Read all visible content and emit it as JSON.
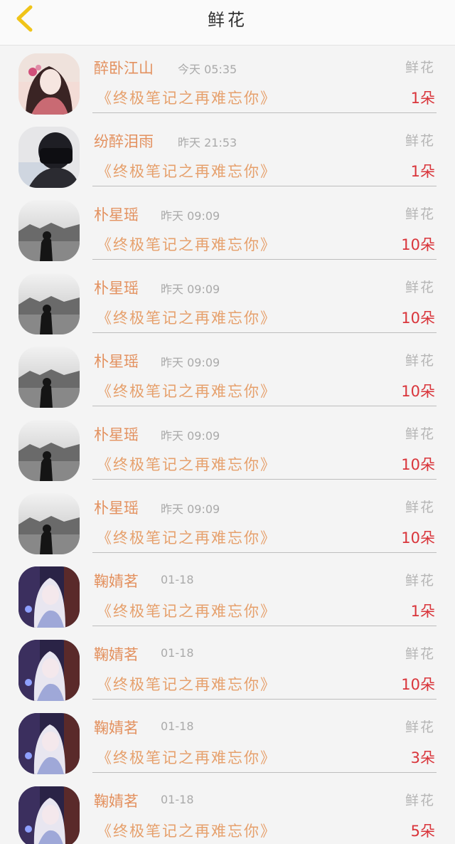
{
  "header": {
    "title": "鲜花",
    "back_icon": "chevron-left-icon",
    "accent_color": "#f0c419"
  },
  "gifts": [
    {
      "name": "醉卧江山",
      "time": "今天 05:35",
      "type": "鲜花",
      "book": "《终极笔记之再难忘你》",
      "amount": "1朵",
      "avatar": "portrait-girl-avatar"
    },
    {
      "name": "纷醉泪雨",
      "time": "昨天 21:53",
      "type": "鲜花",
      "book": "《终极笔记之再难忘你》",
      "amount": "1朵",
      "avatar": "masked-person-avatar"
    },
    {
      "name": "朴星瑶",
      "time": "昨天 09:09",
      "type": "鲜花",
      "book": "《终极笔记之再难忘你》",
      "amount": "10朵",
      "avatar": "bw-landscape-avatar"
    },
    {
      "name": "朴星瑶",
      "time": "昨天 09:09",
      "type": "鲜花",
      "book": "《终极笔记之再难忘你》",
      "amount": "10朵",
      "avatar": "bw-landscape-avatar"
    },
    {
      "name": "朴星瑶",
      "time": "昨天 09:09",
      "type": "鲜花",
      "book": "《终极笔记之再难忘你》",
      "amount": "10朵",
      "avatar": "bw-landscape-avatar"
    },
    {
      "name": "朴星瑶",
      "time": "昨天 09:09",
      "type": "鲜花",
      "book": "《终极笔记之再难忘你》",
      "amount": "10朵",
      "avatar": "bw-landscape-avatar"
    },
    {
      "name": "朴星瑶",
      "time": "昨天 09:09",
      "type": "鲜花",
      "book": "《终极笔记之再难忘你》",
      "amount": "10朵",
      "avatar": "bw-landscape-avatar"
    },
    {
      "name": "鞠婧茗",
      "time": "01-18",
      "type": "鲜花",
      "book": "《终极笔记之再难忘你》",
      "amount": "1朵",
      "avatar": "anime-girl-avatar"
    },
    {
      "name": "鞠婧茗",
      "time": "01-18",
      "type": "鲜花",
      "book": "《终极笔记之再难忘你》",
      "amount": "10朵",
      "avatar": "anime-girl-avatar"
    },
    {
      "name": "鞠婧茗",
      "time": "01-18",
      "type": "鲜花",
      "book": "《终极笔记之再难忘你》",
      "amount": "3朵",
      "avatar": "anime-girl-avatar"
    },
    {
      "name": "鞠婧茗",
      "time": "01-18",
      "type": "鲜花",
      "book": "《终极笔记之再难忘你》",
      "amount": "5朵",
      "avatar": "anime-girl-avatar"
    }
  ]
}
